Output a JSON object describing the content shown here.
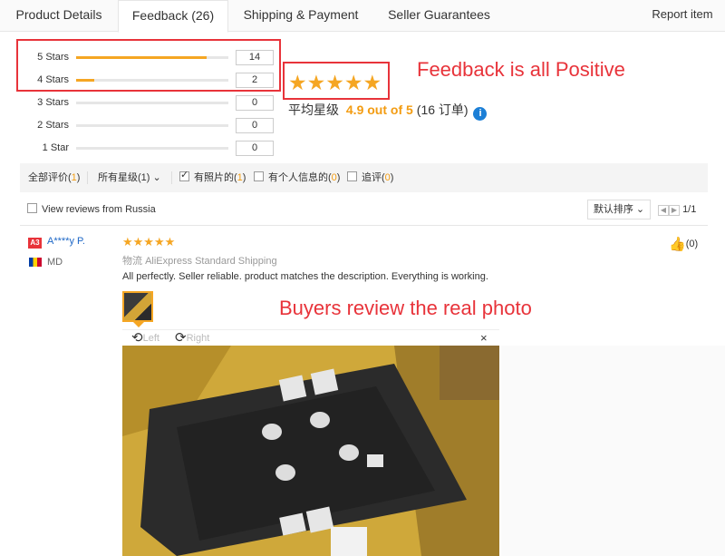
{
  "tabs": {
    "product_details": "Product Details",
    "feedback": "Feedback (26)",
    "shipping_payment": "Shipping & Payment",
    "seller_guarantees": "Seller Guarantees",
    "report_item": "Report item"
  },
  "rating_breakdown": [
    {
      "label": "5 Stars",
      "count": "14",
      "fill": 0.86
    },
    {
      "label": "4 Stars",
      "count": "2",
      "fill": 0.12
    },
    {
      "label": "3 Stars",
      "count": "0",
      "fill": 0
    },
    {
      "label": "2 Stars",
      "count": "0",
      "fill": 0
    },
    {
      "label": "1 Star",
      "count": "0",
      "fill": 0
    }
  ],
  "summary": {
    "stars": "★★★★★",
    "avg_label": "平均星级",
    "score": "4.9 out of 5",
    "orders": "(16 订单)",
    "info_icon": "i"
  },
  "annotations": {
    "positive": "Feedback is all Positive",
    "real_photo": "Buyers review the real photo"
  },
  "filters": {
    "all_label": "全部评价",
    "all_count": "1",
    "all_stars_label": "所有星级",
    "all_stars_count": "1",
    "with_photos_label": "有照片的",
    "with_photos_count": "1",
    "personal_info_label": "有个人信息的",
    "personal_info_count": "0",
    "additional_label": "追评",
    "additional_count": "0",
    "russia_label": "View reviews from Russia",
    "sort_label": "默认排序",
    "page": "1/1"
  },
  "review": {
    "badge": "A3",
    "user": "A****y P.",
    "country": "MD",
    "stars": "★★★★★",
    "shipping_prefix": "物流",
    "shipping": "AliExpress Standard Shipping",
    "text": "All perfectly. Seller reliable. product matches the description. Everything is working.",
    "helpful_count": "(0)"
  },
  "viewer": {
    "left": "Left",
    "right": "Right",
    "close": "×"
  },
  "colors": {
    "accent_orange": "#f5a623",
    "annotation_red": "#e8333a",
    "link_blue": "#1c66c6"
  }
}
